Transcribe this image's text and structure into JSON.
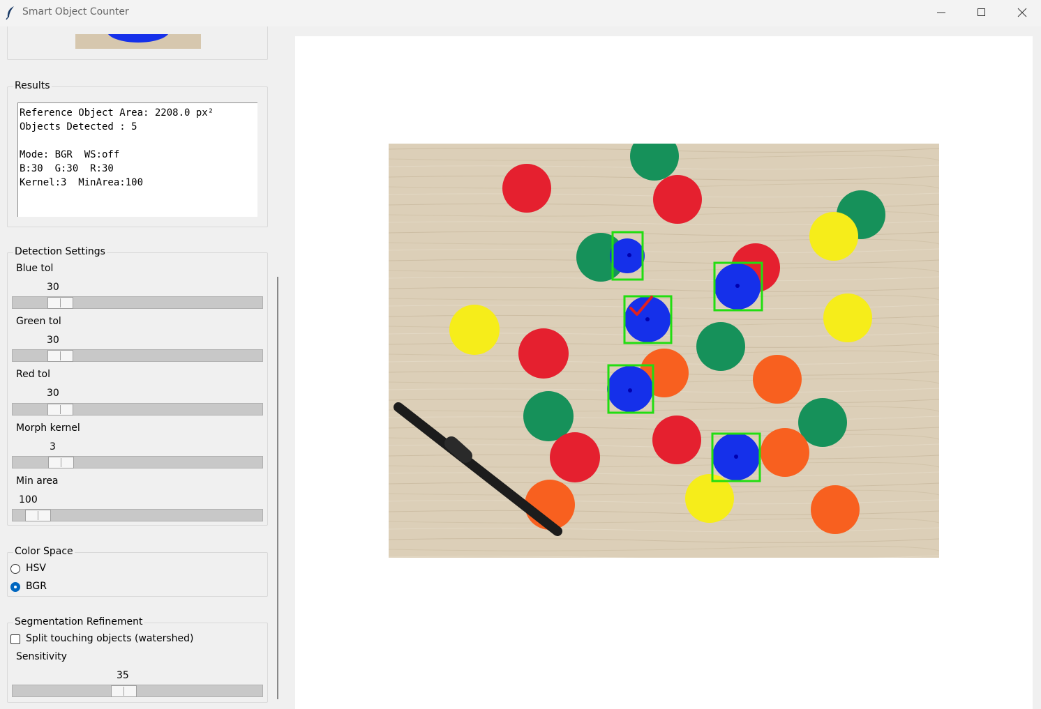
{
  "window": {
    "title": "Smart Object Counter",
    "min_glyph": "minimize-icon",
    "max_glyph": "maximize-icon",
    "close_glyph": "close-icon"
  },
  "results": {
    "title": "Results",
    "lines": [
      "Reference Object Area: 2208.0 px²",
      "Objects Detected : 5",
      "",
      "Mode: BGR  WS:off",
      "B:30  G:30  R:30",
      "Kernel:3  MinArea:100"
    ]
  },
  "detection": {
    "title": "Detection Settings",
    "sliders": [
      {
        "label": "Blue tol",
        "value": "30",
        "fraction": 0.155
      },
      {
        "label": "Green tol",
        "value": "30",
        "fraction": 0.155
      },
      {
        "label": "Red tol",
        "value": "30",
        "fraction": 0.155
      },
      {
        "label": "Morph kernel",
        "value": "3",
        "fraction": 0.16
      },
      {
        "label": "Min area",
        "value": "100",
        "fraction": 0.055
      }
    ]
  },
  "color_space": {
    "title": "Color Space",
    "options": [
      {
        "label": "HSV",
        "selected": false
      },
      {
        "label": "BGR",
        "selected": true
      }
    ]
  },
  "segmentation": {
    "title": "Segmentation Refinement",
    "checkbox_label": "Split touching objects (watershed)",
    "checked": false,
    "sensitivity_label": "Sensitivity",
    "sensitivity_value": "35",
    "sensitivity_fraction": 0.44
  },
  "colors": {
    "detection_box": "#22dd11",
    "selected_blue": "#1530ea",
    "checkmark": "#e02020"
  },
  "objects_detected": 5
}
